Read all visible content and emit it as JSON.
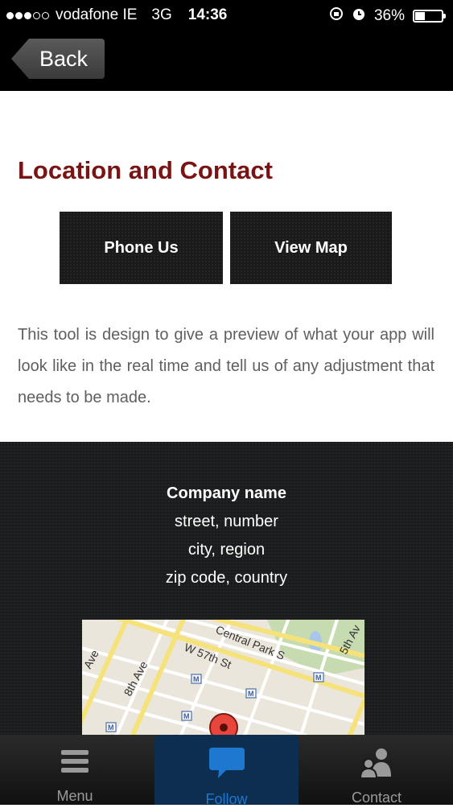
{
  "status_bar": {
    "carrier": "vodafone IE",
    "network": "3G",
    "time": "14:36",
    "battery": "36%",
    "battery_level": 0.36,
    "signal_bars": 3,
    "signal_max": 5
  },
  "nav": {
    "back_label": "Back"
  },
  "content": {
    "title": "Location and Contact",
    "phone_button": "Phone Us",
    "map_button": "View Map",
    "description": "This tool is design to give a preview of what your app will look like in the real time and tell us of any adjustment that needs to be made."
  },
  "address": {
    "company": "Company name",
    "street": "street, number",
    "city": "city, region",
    "zip": "zip code, country"
  },
  "map": {
    "labels": [
      "Central Park S",
      "W 57th St",
      "8th Ave",
      "5th Av",
      "Ave",
      "M"
    ]
  },
  "tab_bar": {
    "items": [
      {
        "label": "Menu",
        "icon": "menu-icon"
      },
      {
        "label": "Follow",
        "icon": "chat-bubble-icon",
        "active": true
      },
      {
        "label": "Contact",
        "icon": "contact-icon"
      }
    ]
  },
  "colors": {
    "title": "#7a1414",
    "active_tab": "#1e78d0",
    "dark_bg": "#1b1c1d"
  }
}
